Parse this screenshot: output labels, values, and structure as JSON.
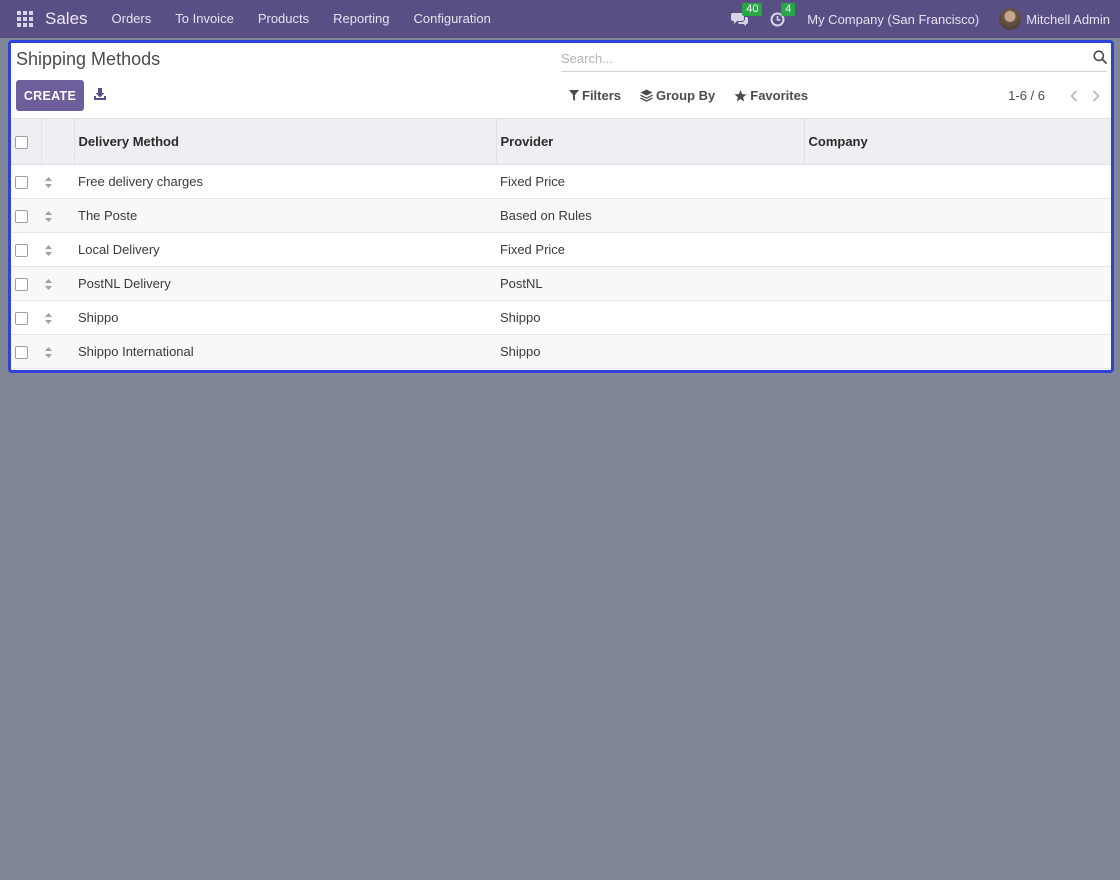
{
  "navbar": {
    "brand": "Sales",
    "menu": [
      "Orders",
      "To Invoice",
      "Products",
      "Reporting",
      "Configuration"
    ],
    "messages_count": "40",
    "activities_count": "4",
    "company": "My Company (San Francisco)",
    "user": "Mitchell Admin",
    "colors": {
      "background": "#5a4f85",
      "badge": "#28a745"
    }
  },
  "control_panel": {
    "title": "Shipping Methods",
    "create_label": "CREATE",
    "search_placeholder": "Search...",
    "filters_label": "Filters",
    "group_by_label": "Group By",
    "favorites_label": "Favorites",
    "pager": "1-6 / 6",
    "colors": {
      "primary": "#6f5e9c",
      "focus_border": "#2f43d6"
    }
  },
  "table": {
    "columns": [
      "Delivery Method",
      "Provider",
      "Company"
    ],
    "rows": [
      {
        "method": "Free delivery charges",
        "provider": "Fixed Price",
        "company": ""
      },
      {
        "method": "The Poste",
        "provider": "Based on Rules",
        "company": ""
      },
      {
        "method": "Local Delivery",
        "provider": "Fixed Price",
        "company": ""
      },
      {
        "method": "PostNL Delivery",
        "provider": "PostNL",
        "company": ""
      },
      {
        "method": "Shippo",
        "provider": "Shippo",
        "company": ""
      },
      {
        "method": "Shippo International",
        "provider": "Shippo",
        "company": ""
      }
    ]
  },
  "icons": [
    "apps-grid-icon",
    "chat-icon",
    "clock-icon",
    "download-icon",
    "search-icon",
    "filter-icon",
    "layers-icon",
    "star-icon",
    "chevron-left-icon",
    "chevron-right-icon",
    "drag-handle-icon"
  ]
}
